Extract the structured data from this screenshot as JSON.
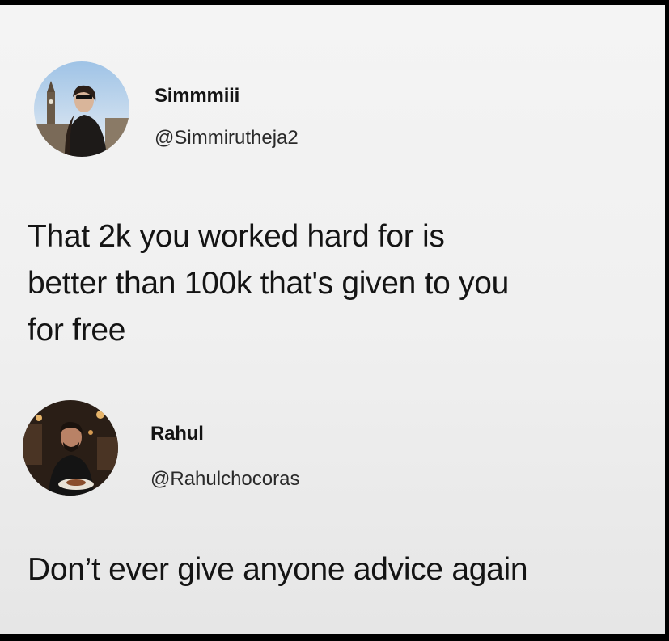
{
  "posts": [
    {
      "display_name": "Simmmiii",
      "handle": "@Simmirutheja2",
      "avatar_icon": "avatar-photo-woman-london",
      "text_lines": [
        "That 2k you worked hard for is",
        "better than 100k that's given to you",
        "for free"
      ]
    },
    {
      "display_name": "Rahul",
      "handle": "@Rahulchocoras",
      "avatar_icon": "avatar-photo-man-restaurant",
      "text_lines": [
        "Don’t ever give anyone advice again"
      ]
    }
  ]
}
